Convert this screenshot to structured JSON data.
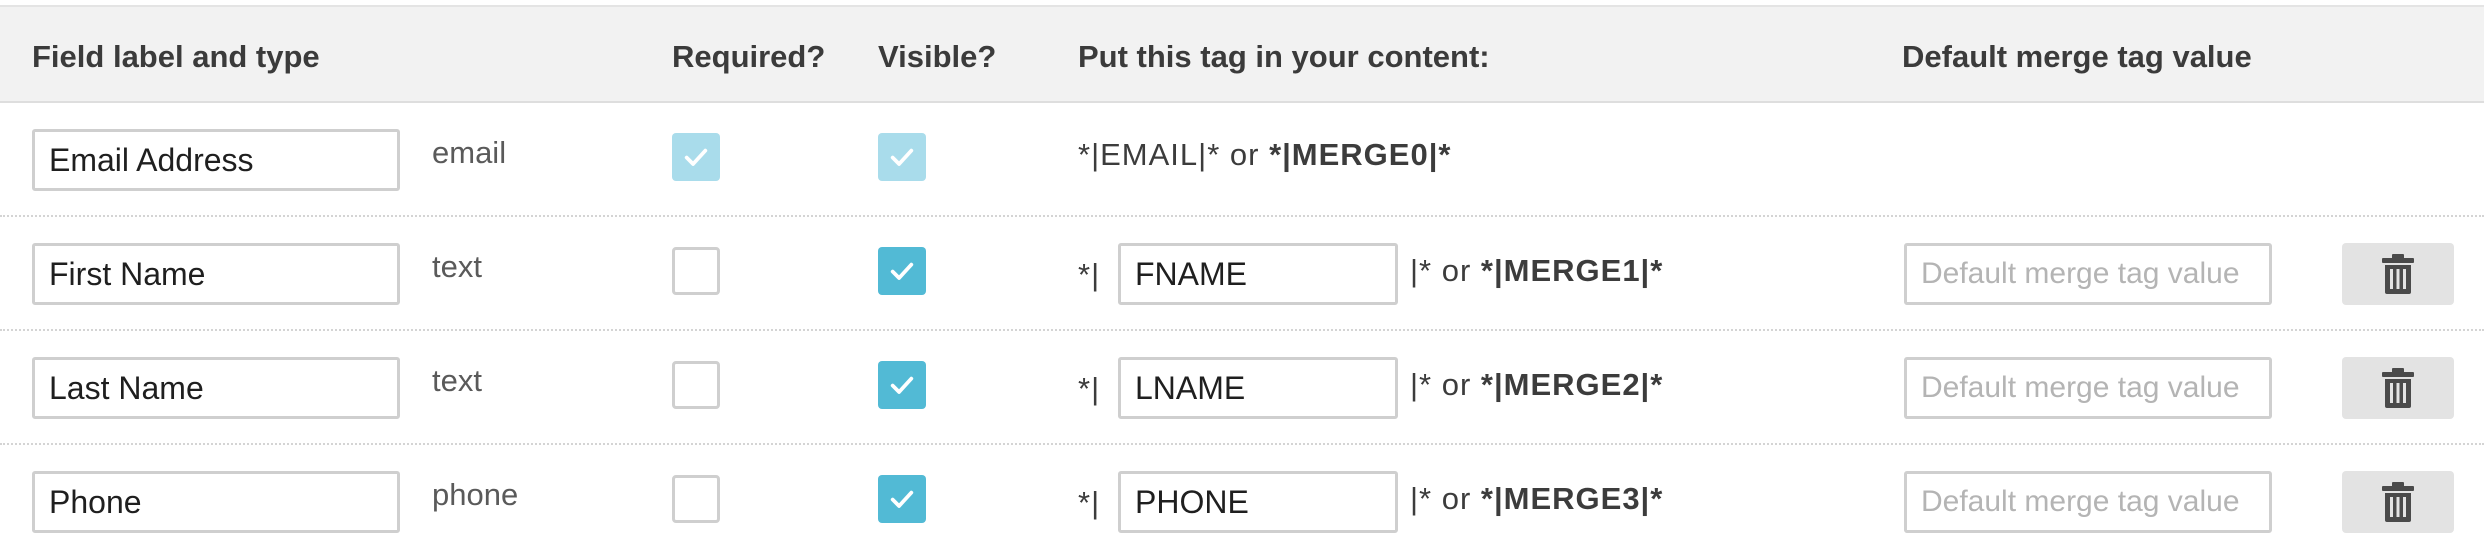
{
  "header": {
    "col_label": "Field label and type",
    "col_required": "Required?",
    "col_visible": "Visible?",
    "col_tag": "Put this tag in your content:",
    "col_default": "Default merge tag value"
  },
  "accent_color": "#52bad5",
  "rows": [
    {
      "label": "Email Address",
      "type": "email",
      "required": true,
      "visible": true,
      "locked": true,
      "tag_text": "*|EMAIL|* or ",
      "merge_tag": "*|MERGE0|*"
    },
    {
      "label": "First Name",
      "type": "text",
      "required": false,
      "visible": true,
      "tag_prefix": "*|",
      "tag": "FNAME",
      "tag_suffix": "|* or ",
      "merge_tag": "*|MERGE1|*",
      "default_placeholder": "Default merge tag value",
      "delete_icon": "trash-icon"
    },
    {
      "label": "Last Name",
      "type": "text",
      "required": false,
      "visible": true,
      "tag_prefix": "*|",
      "tag": "LNAME",
      "tag_suffix": "|* or ",
      "merge_tag": "*|MERGE2|*",
      "default_placeholder": "Default merge tag value",
      "delete_icon": "trash-icon"
    },
    {
      "label": "Phone",
      "type": "phone",
      "required": false,
      "visible": true,
      "tag_prefix": "*|",
      "tag": "PHONE",
      "tag_suffix": "|* or ",
      "merge_tag": "*|MERGE3|*",
      "default_placeholder": "Default merge tag value",
      "delete_icon": "trash-icon"
    }
  ]
}
